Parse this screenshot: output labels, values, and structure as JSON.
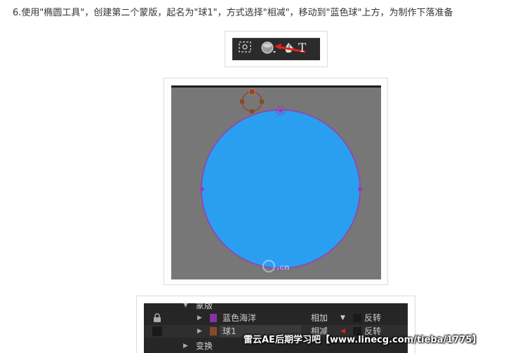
{
  "instruction": "6.使用\"椭圆工具\"，创建第二个蒙版，起名为\"球1\"，方式选择\"相减\"，移动到\"蓝色球\"上方，为制作下落准备",
  "toolbar": {
    "icons": [
      "selection-marquee-icon",
      "ellipse-tool-icon",
      "pen-tool-icon",
      "text-tool-icon"
    ],
    "text_tool_glyph": "T",
    "accent_arrow_color": "#e0211b"
  },
  "comp": {
    "background_color": "#777777",
    "ball_color": "#2a9ff0",
    "mask_path_color": "#9b3bb5",
    "new_mask_color": "#8a4a2a",
    "watermark": "UI.cn"
  },
  "layers": {
    "mask_group_label": "蒙版",
    "masks": [
      {
        "name": "蓝色海洋",
        "mode": "相加",
        "invert_label": "反转",
        "color": "#8b2fa3"
      },
      {
        "name": "球1",
        "mode": "相减",
        "invert_label": "反转",
        "color": "#8a4a2a"
      }
    ],
    "transform_label": "变换"
  },
  "footer_watermark": "雷云AE后期学习吧【www.linecg.com/tieba/1775】"
}
